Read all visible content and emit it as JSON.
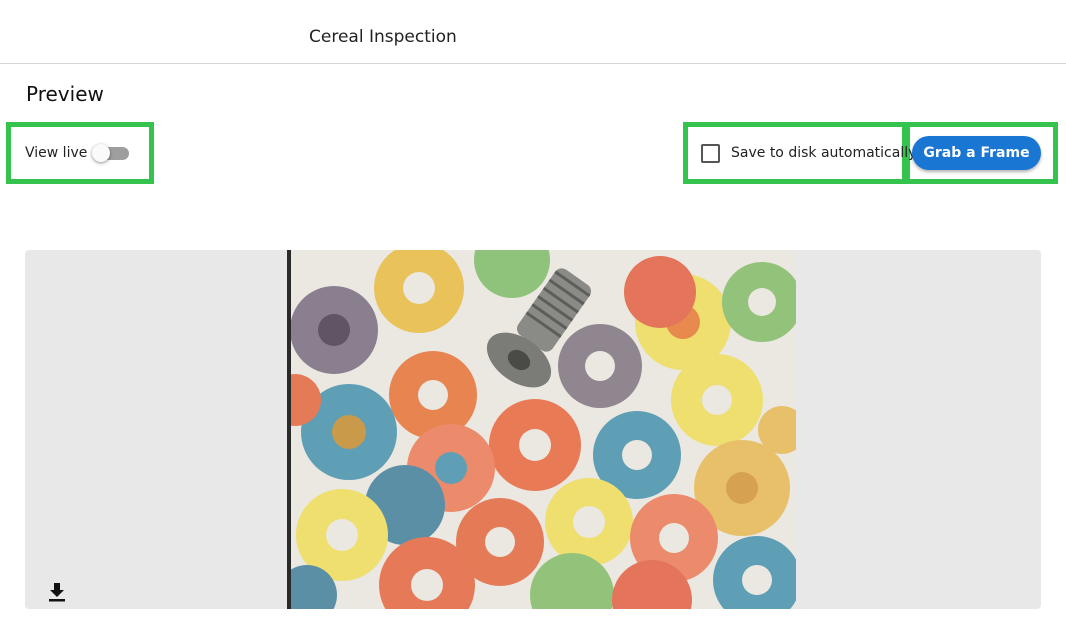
{
  "header": {
    "title": "Cereal Inspection"
  },
  "preview": {
    "title": "Preview",
    "view_live_label": "View live",
    "view_live_on": false,
    "save_to_disk_label": "Save to disk automatically",
    "save_to_disk_checked": false,
    "grab_button_label": "Grab a Frame",
    "download_icon": "download-icon"
  },
  "colors": {
    "accent": "#1976d2",
    "highlight": "#34c44e",
    "panel_background": "#e8e8e8"
  }
}
